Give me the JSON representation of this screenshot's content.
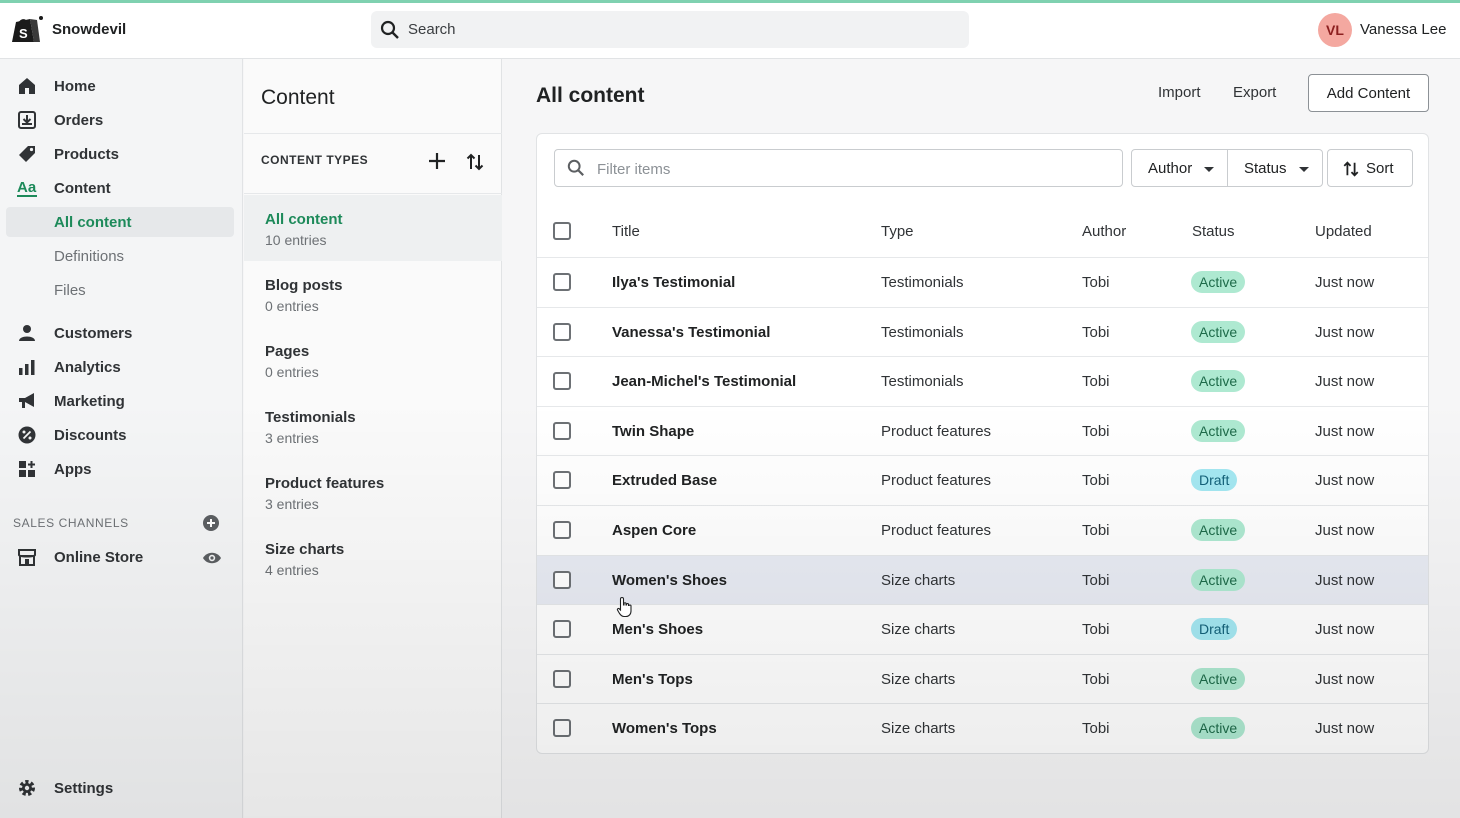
{
  "topbar": {
    "store_name": "Snowdevil",
    "search_placeholder": "Search",
    "user_initials": "VL",
    "user_name": "Vanessa Lee"
  },
  "sidebar": {
    "items": [
      {
        "label": "Home",
        "icon": "home-icon"
      },
      {
        "label": "Orders",
        "icon": "orders-icon"
      },
      {
        "label": "Products",
        "icon": "tag-icon"
      },
      {
        "label": "Content",
        "icon": "content-icon"
      }
    ],
    "content_sub": [
      {
        "label": "All content",
        "active": true
      },
      {
        "label": "Definitions",
        "active": false
      },
      {
        "label": "Files",
        "active": false
      }
    ],
    "items2": [
      {
        "label": "Customers",
        "icon": "person-icon"
      },
      {
        "label": "Analytics",
        "icon": "bar-chart-icon"
      },
      {
        "label": "Marketing",
        "icon": "megaphone-icon"
      },
      {
        "label": "Discounts",
        "icon": "discount-icon"
      },
      {
        "label": "Apps",
        "icon": "apps-icon"
      }
    ],
    "sales_channels_title": "SALES CHANNELS",
    "online_store": "Online Store",
    "settings": "Settings"
  },
  "content_types": {
    "heading": "Content",
    "label": "CONTENT TYPES",
    "items": [
      {
        "name": "All content",
        "count": "10 entries"
      },
      {
        "name": "Blog posts",
        "count": "0 entries"
      },
      {
        "name": "Pages",
        "count": "0 entries"
      },
      {
        "name": "Testimonials",
        "count": "3 entries"
      },
      {
        "name": "Product features",
        "count": "3 entries"
      },
      {
        "name": "Size charts",
        "count": "4 entries"
      }
    ]
  },
  "main": {
    "title": "All content",
    "import_label": "Import",
    "export_label": "Export",
    "add_label": "Add Content",
    "filter_placeholder": "Filter items",
    "author_label": "Author",
    "status_label": "Status",
    "sort_label": "Sort",
    "columns": [
      "Title",
      "Type",
      "Author",
      "Status",
      "Updated"
    ],
    "rows": [
      {
        "title": "Ilya's Testimonial",
        "type": "Testimonials",
        "author": "Tobi",
        "status": "Active",
        "updated": "Just now"
      },
      {
        "title": "Vanessa's Testimonial",
        "type": "Testimonials",
        "author": "Tobi",
        "status": "Active",
        "updated": "Just now"
      },
      {
        "title": "Jean-Michel's Testimonial",
        "type": "Testimonials",
        "author": "Tobi",
        "status": "Active",
        "updated": "Just now"
      },
      {
        "title": "Twin Shape",
        "type": "Product features",
        "author": "Tobi",
        "status": "Active",
        "updated": "Just now"
      },
      {
        "title": "Extruded Base",
        "type": "Product features",
        "author": "Tobi",
        "status": "Draft",
        "updated": "Just now"
      },
      {
        "title": "Aspen Core",
        "type": "Product features",
        "author": "Tobi",
        "status": "Active",
        "updated": "Just now"
      },
      {
        "title": "Women's Shoes",
        "type": "Size charts",
        "author": "Tobi",
        "status": "Active",
        "updated": "Just now"
      },
      {
        "title": "Men's Shoes",
        "type": "Size charts",
        "author": "Tobi",
        "status": "Draft",
        "updated": "Just now"
      },
      {
        "title": "Men's Tops",
        "type": "Size charts",
        "author": "Tobi",
        "status": "Active",
        "updated": "Just now"
      },
      {
        "title": "Women's Tops",
        "type": "Size charts",
        "author": "Tobi",
        "status": "Active",
        "updated": "Just now"
      }
    ]
  },
  "colors": {
    "accent_green": "#1d8a5a",
    "active_badge": "#aee9d1",
    "draft_badge": "#a4e8f2"
  }
}
